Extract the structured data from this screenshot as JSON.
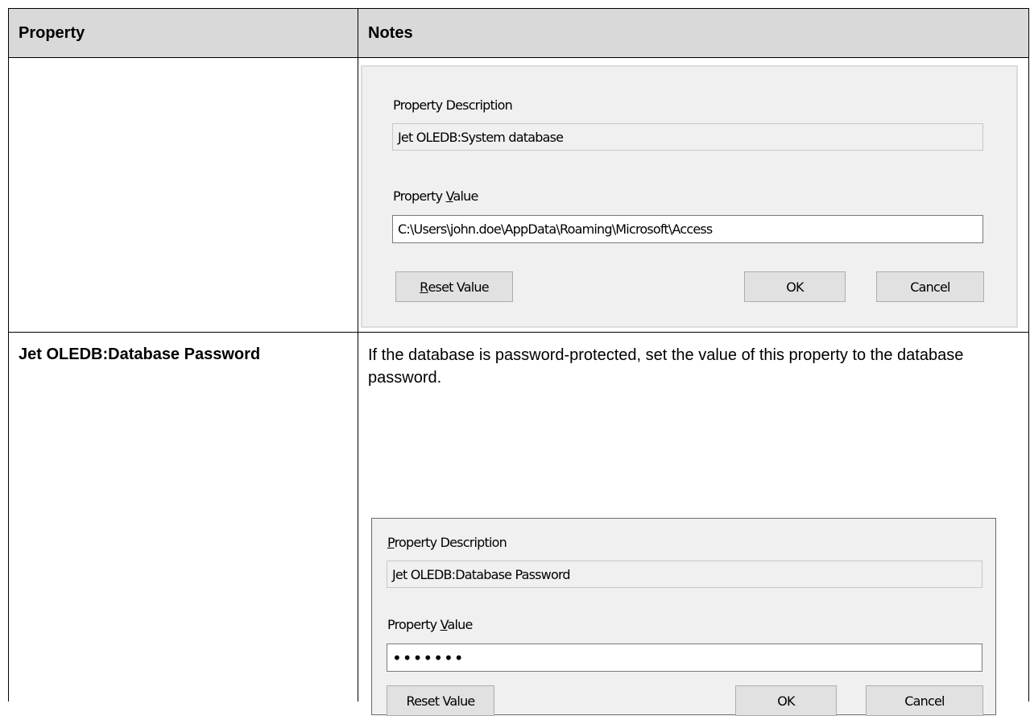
{
  "table": {
    "header_property": "Property",
    "header_notes": "Notes",
    "row2": {
      "property": "Jet OLEDB:Database Password",
      "description": "If the database is password-protected, set the value of this property to the database password."
    }
  },
  "dialog1": {
    "desc_label": "Property Description",
    "desc_value": "Jet OLEDB:System database",
    "value_label_prefix": "Property ",
    "value_label_mnemonic": "V",
    "value_label_suffix": "alue",
    "value": "C:\\Users\\john.doe\\AppData\\Roaming\\Microsoft\\Access",
    "reset_mnemonic": "R",
    "reset_suffix": "eset Value",
    "ok": "OK",
    "cancel": "Cancel"
  },
  "dialog2": {
    "desc_label_mnemonic": "P",
    "desc_label_suffix": "roperty Description",
    "desc_value": "Jet OLEDB:Database Password",
    "value_label_prefix": "Property ",
    "value_label_mnemonic": "V",
    "value_label_suffix": "alue",
    "value_masked": "•••••••",
    "reset": "Reset Value",
    "ok": "OK",
    "cancel": "Cancel"
  }
}
